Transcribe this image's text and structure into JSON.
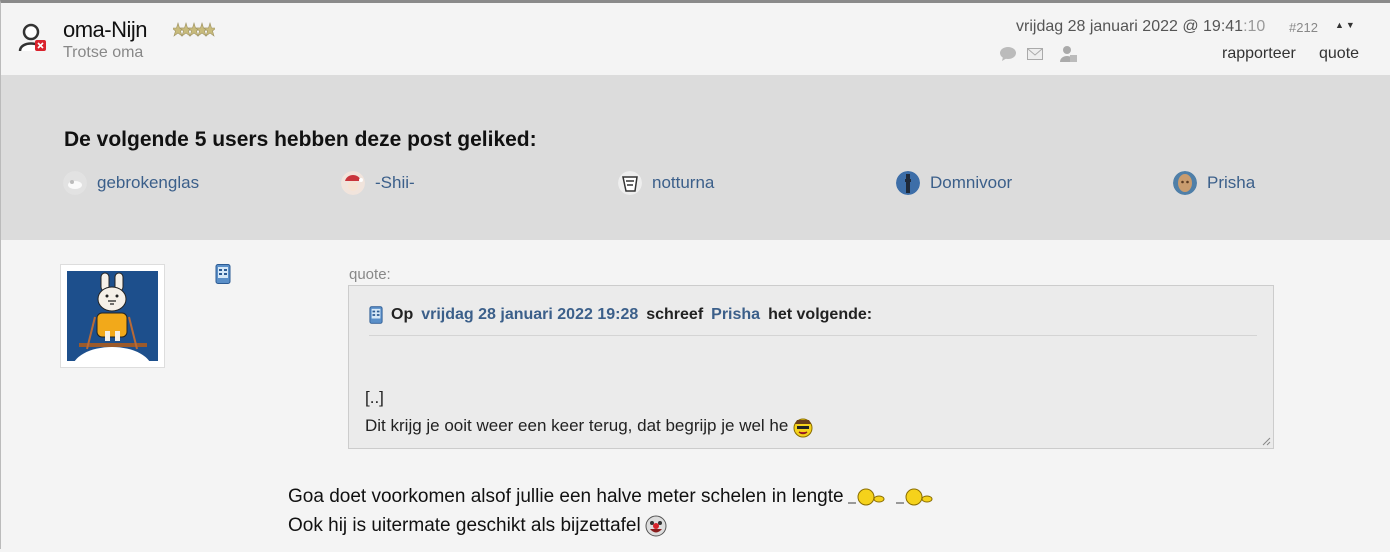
{
  "header": {
    "username": "oma-Nijn",
    "user_title": "Trotse oma",
    "date": "vrijdag 28 januari 2022 @ 19:41",
    "seconds": ":10",
    "post_number": "#212",
    "updown": "▲▼",
    "rapporteer_label": "rapporteer",
    "quote_label": "quote",
    "icons": [
      "user-status-icon",
      "rank-stars-icon",
      "chat-bubble-icon",
      "mail-icon",
      "user-profile-icon"
    ]
  },
  "likes": {
    "title": "De volgende 5 users hebben deze post geliked:",
    "users": [
      {
        "name": "gebrokenglas"
      },
      {
        "name": "-Shii-"
      },
      {
        "name": "notturna"
      },
      {
        "name": "Domnivoor"
      },
      {
        "name": "Prisha"
      }
    ]
  },
  "post": {
    "quote_label": "quote:",
    "quote": {
      "prefix": "Op",
      "date_link": "vrijdag 28 januari 2022 19:28",
      "middle": "schreef",
      "author_link": "Prisha",
      "suffix": "het volgende:",
      "line1": "[..]",
      "line2": "Dit krijg je ooit weer een keer terug, dat begrijp je wel he"
    },
    "line1": "Goa doet voorkomen alsof jullie een halve meter schelen in lengte",
    "line2": "Ook hij is uitermate geschikt als bijzettafel"
  },
  "colors": {
    "link": "#3b5f8a",
    "likes_bg": "#dcdcdc",
    "page_bg": "#f4f4f4",
    "quote_bg": "#ebebeb"
  }
}
